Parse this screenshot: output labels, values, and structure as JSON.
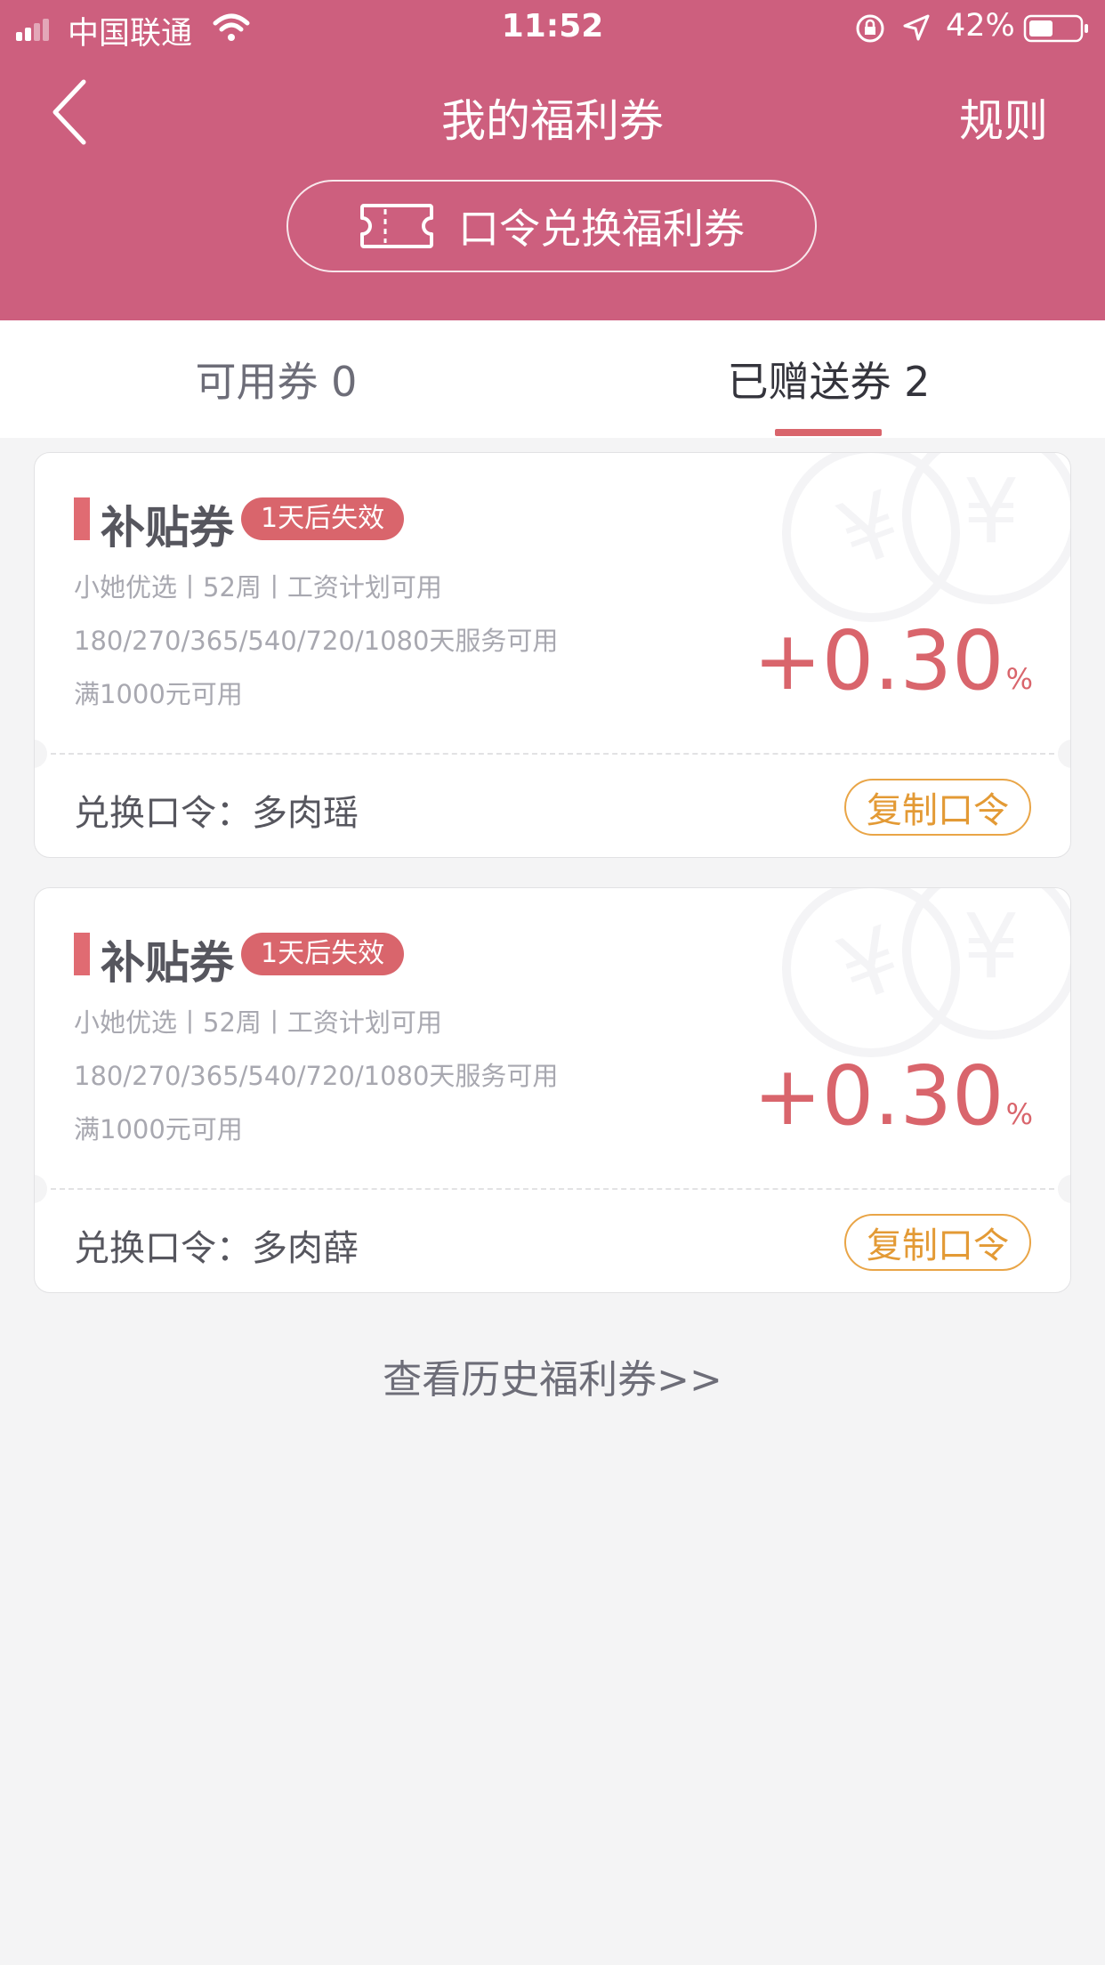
{
  "status_bar": {
    "carrier": "中国联通",
    "time": "11:52",
    "battery": "42%"
  },
  "header": {
    "title": "我的福利券",
    "rules": "规则",
    "redeem_button": "口令兑换福利券",
    "background_color": "#cd5f7e"
  },
  "tabs": [
    {
      "label": "可用券 0"
    },
    {
      "label": "已赠送券 2"
    }
  ],
  "selected_tab": 1,
  "coupons": [
    {
      "title": "补贴券",
      "expire": "1天后失效",
      "line1": "小她优选丨52周丨工资计划可用",
      "line2": "180/270/365/540/720/1080天服务可用",
      "line3": "满1000元可用",
      "rate": "+0.30",
      "rate_unit": "%",
      "code_label": "兑换口令：多肉瑶",
      "copy_button": "复制口令"
    },
    {
      "title": "补贴券",
      "expire": "1天后失效",
      "line1": "小她优选丨52周丨工资计划可用",
      "line2": "180/270/365/540/720/1080天服务可用",
      "line3": "满1000元可用",
      "rate": "+0.30",
      "rate_unit": "%",
      "code_label": "兑换口令：多肉薛",
      "copy_button": "复制口令"
    }
  ],
  "history_link": "查看历史福利券>>",
  "colors": {
    "accent": "#d9656c",
    "copy_button": "#e39a35"
  }
}
